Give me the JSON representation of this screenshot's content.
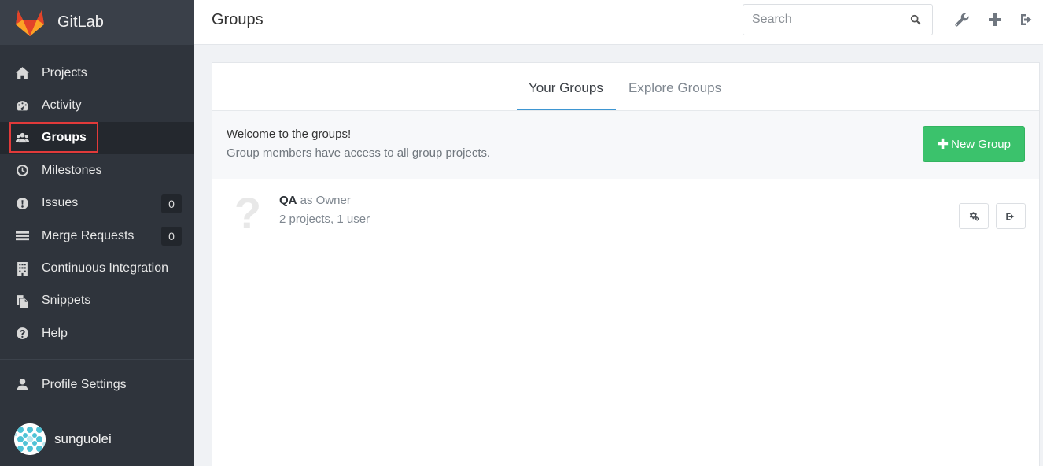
{
  "app": {
    "name": "GitLab"
  },
  "header": {
    "title": "Groups",
    "search_placeholder": "Search",
    "icons": [
      "admin-wrench-icon",
      "new-plus-icon",
      "sign-out-icon"
    ]
  },
  "sidebar": {
    "items": [
      {
        "label": "Projects",
        "icon": "home-icon"
      },
      {
        "label": "Activity",
        "icon": "dashboard-icon"
      },
      {
        "label": "Groups",
        "icon": "group-icon",
        "active": true
      },
      {
        "label": "Milestones",
        "icon": "clock-icon"
      },
      {
        "label": "Issues",
        "icon": "exclamation-icon",
        "count": "0"
      },
      {
        "label": "Merge Requests",
        "icon": "list-icon",
        "count": "0"
      },
      {
        "label": "Continuous Integration",
        "icon": "building-icon"
      },
      {
        "label": "Snippets",
        "icon": "copy-icon"
      },
      {
        "label": "Help",
        "icon": "question-icon"
      }
    ],
    "profile": {
      "label": "Profile Settings",
      "icon": "user-icon"
    },
    "user": {
      "name": "sunguolei"
    }
  },
  "tabs": {
    "your_groups": "Your Groups",
    "explore_groups": "Explore Groups"
  },
  "welcome": {
    "title": "Welcome to the groups!",
    "subtitle": "Group members have access to all group projects.",
    "new_group_label": "New Group",
    "new_group_prefix": "✚"
  },
  "groups": [
    {
      "avatar": "?",
      "name": "QA",
      "role": "as Owner",
      "meta": "2 projects, 1 user"
    }
  ],
  "colors": {
    "sidebar_bg": "#2f343c",
    "accent_blue": "#3e96d2",
    "success_green": "#3bc26c",
    "highlight_red": "#e13a3a"
  }
}
